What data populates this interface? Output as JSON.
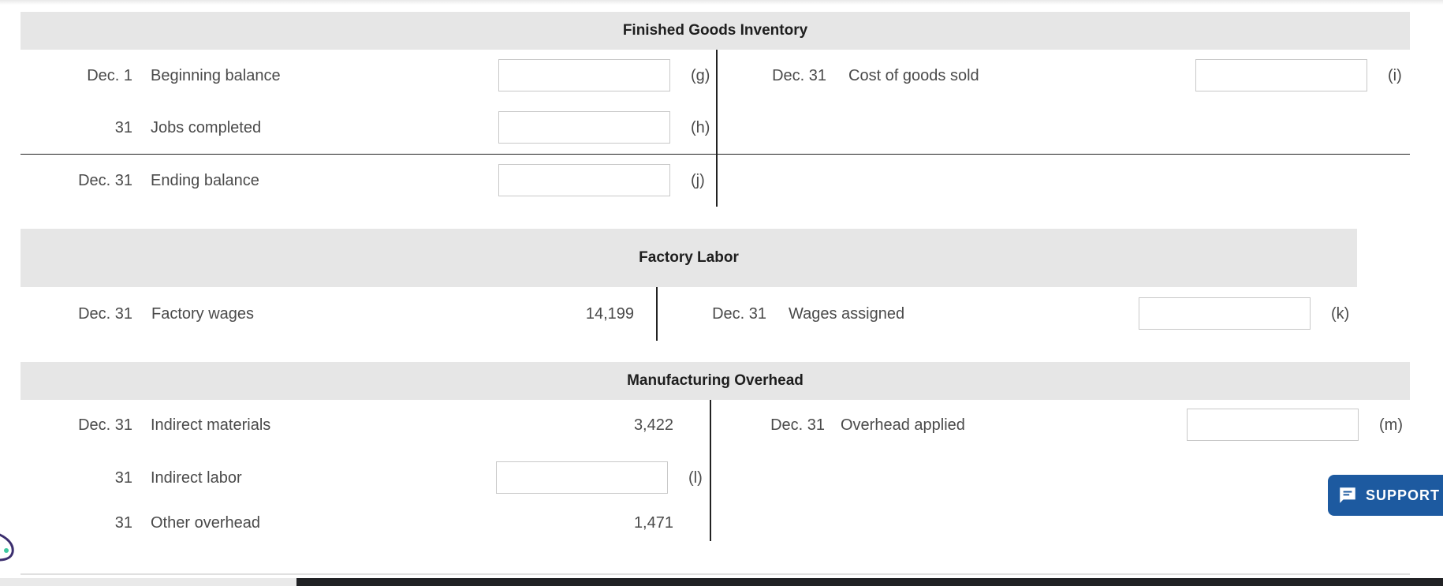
{
  "sections": {
    "finished_goods": {
      "title": "Finished Goods Inventory",
      "debits": [
        {
          "date": "Dec. 1",
          "label": "Beginning balance",
          "marker": "(g)"
        },
        {
          "date": "31",
          "label": "Jobs completed",
          "marker": "(h)"
        }
      ],
      "credits": [
        {
          "date": "Dec. 31",
          "label": "Cost of goods sold",
          "marker": "(i)"
        }
      ],
      "ending": {
        "date": "Dec. 31",
        "label": "Ending balance",
        "marker": "(j)"
      }
    },
    "factory_labor": {
      "title": "Factory Labor",
      "debits": [
        {
          "date": "Dec. 31",
          "label": "Factory wages",
          "value": "14,199"
        }
      ],
      "credits": [
        {
          "date": "Dec. 31",
          "label": "Wages assigned",
          "marker": "(k)"
        }
      ]
    },
    "manufacturing_overhead": {
      "title": "Manufacturing Overhead",
      "debits": [
        {
          "date": "Dec. 31",
          "label": "Indirect materials",
          "value": "3,422"
        },
        {
          "date": "31",
          "label": "Indirect labor",
          "marker": "(l)"
        },
        {
          "date": "31",
          "label": "Other overhead",
          "value": "1,471"
        }
      ],
      "credits": [
        {
          "date": "Dec. 31",
          "label": "Overhead applied",
          "marker": "(m)"
        }
      ]
    }
  },
  "support": {
    "label": "SUPPORT",
    "icon": "chat-icon"
  },
  "colors": {
    "header_band": "#e6e6e6",
    "support_button": "#1d5aa0",
    "taskbar": "#202124"
  }
}
